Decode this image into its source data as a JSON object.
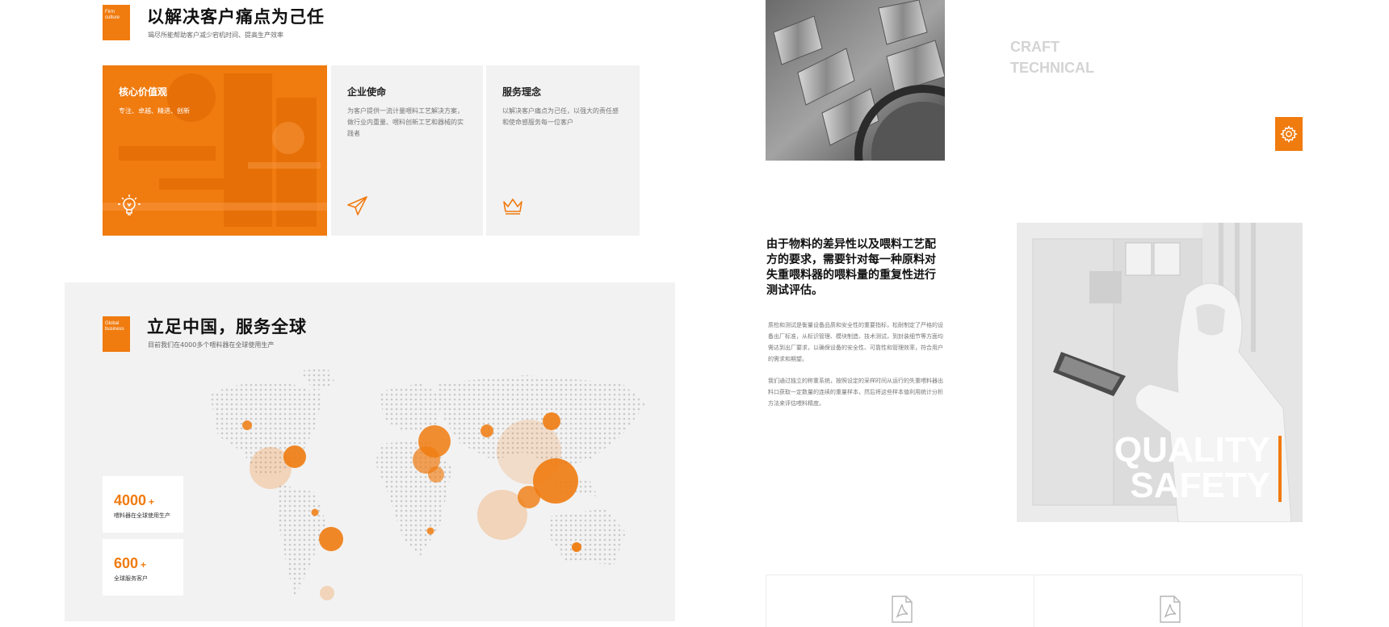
{
  "culture": {
    "tag_text": "Firm culture",
    "title": "以解决客户痛点为己任",
    "subtitle": "竭尽所能帮助客户减少宕机时间、提高生产效率",
    "cards": [
      {
        "title": "核心价值观",
        "desc": "专注、卓越、精进、创新",
        "icon": "lightbulb-icon"
      },
      {
        "title": "企业使命",
        "desc": "为客户提供一流计量喂料工艺解决方案，做行业内重量、喂料创新工艺和器械的实践者",
        "icon": "paper-plane-icon"
      },
      {
        "title": "服务理念",
        "desc": "以解决客户痛点为己任，以强大的责任感和使命感服务每一位客户",
        "icon": "crown-icon"
      }
    ]
  },
  "global": {
    "tag_text": "Global business",
    "title": "立足中国，服务全球",
    "subtitle": "目前我们在4000多个喂料器在全球使用生产",
    "stats": [
      {
        "number": "4000",
        "plus": "+",
        "label": "喂料器在全球使用生产"
      },
      {
        "number": "600",
        "plus": "+",
        "label": "全球服务客户"
      }
    ]
  },
  "craft": {
    "line1": "CRAFT",
    "line2": "TECHNICAL",
    "icon": "gear-icon"
  },
  "quality": {
    "headline": "由于物料的差异性以及喂料工艺配方的要求，需要针对每一种原料对失重喂料器的喂料量的重复性进行测试评估。",
    "paragraph1": "质检和测试是衡量设备品质和安全性的重要指标，松耐制定了严格的设备出厂标准，从标识管理、模块制造、技术测试，到封装细节等方面均需达到出厂要求，以确保设备的安全性、可靠性和管理效率，符合用户的需求和期望。",
    "paragraph2": "我们通过独立的称重系统，按照设定的采样时间从运行的失重喂料器出料口获取一定数量的连续的重量样本，然后将这些样本值利用统计分析方法来评估喂料精度。",
    "overlay_line1": "QUALITY",
    "overlay_line2": "SAFETY"
  },
  "documents": {
    "icons": [
      "pdf-icon",
      "pdf-icon"
    ]
  },
  "colors": {
    "accent": "#f07b0f",
    "panel": "#f2f2f2",
    "muted_heading": "#d4d4d4"
  }
}
